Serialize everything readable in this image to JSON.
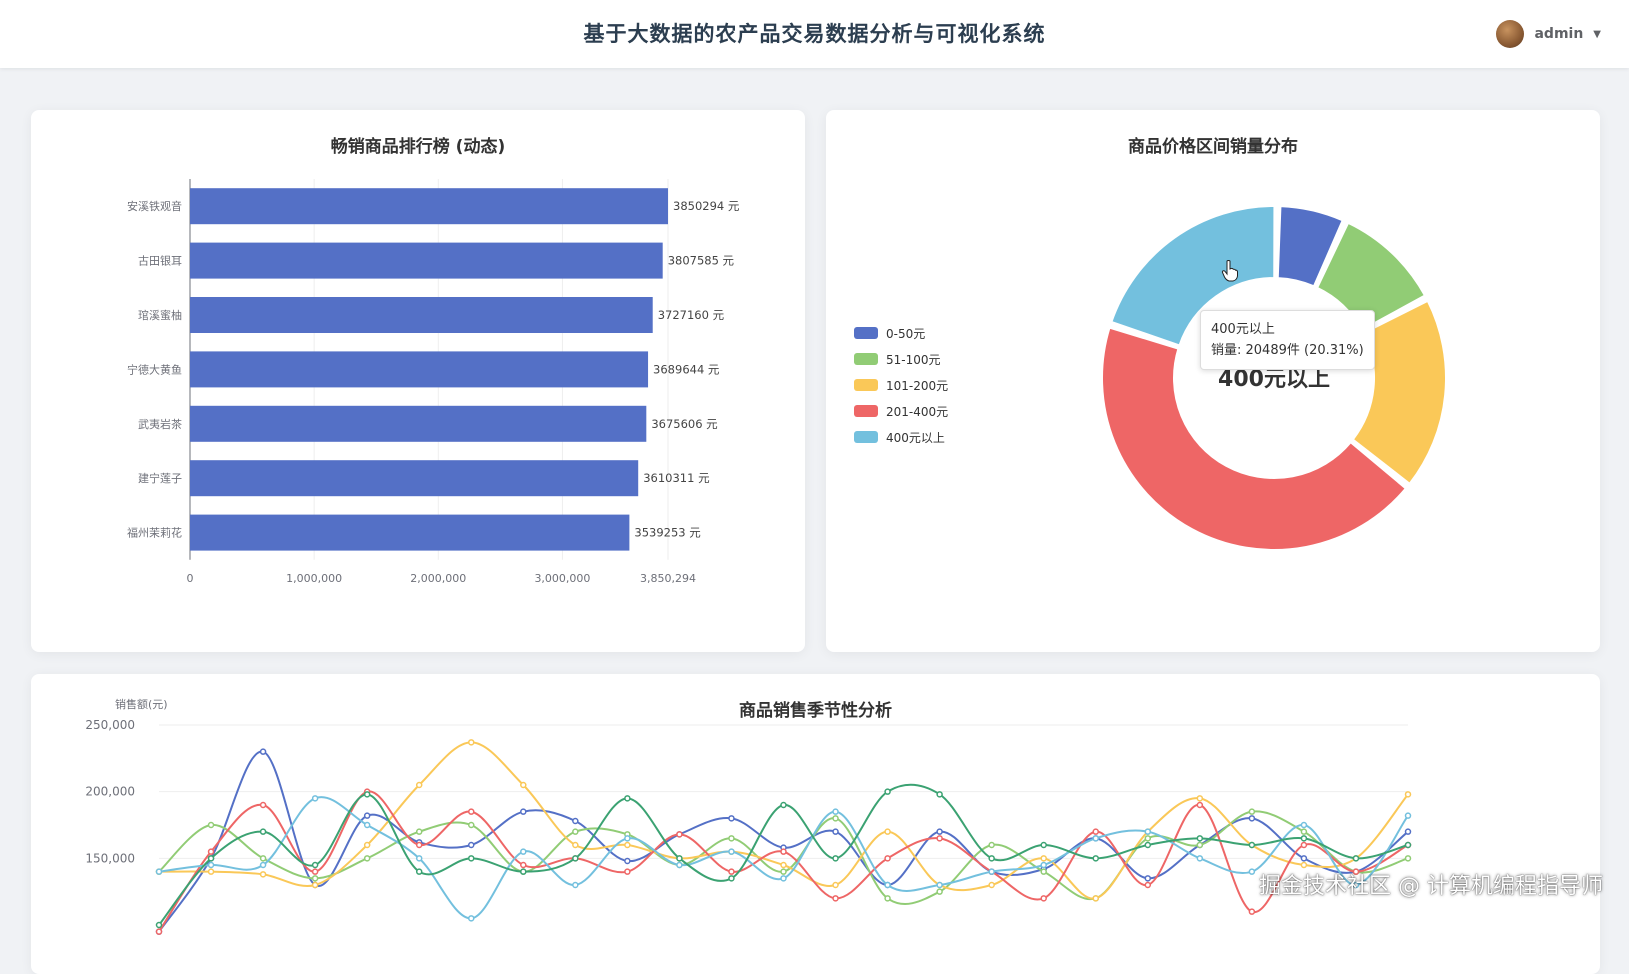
{
  "header": {
    "title": "基于大数据的农产品交易数据分析与可视化系统",
    "username": "admin"
  },
  "ranking": {
    "title": "畅销商品排行榜 (动态)",
    "value_suffix": " 元"
  },
  "price": {
    "title": "商品价格区间销量分布",
    "center_label": "400元以上",
    "tooltip": {
      "name": "400元以上",
      "detail": "销量: 20489件 (20.31%)"
    }
  },
  "season": {
    "title": "商品销售季节性分析",
    "ylabel": "销售额(元)"
  },
  "watermark": "掘金技术社区 @ 计算机编程指导师",
  "chart_data": [
    {
      "type": "bar",
      "orientation": "horizontal",
      "title": "畅销商品排行榜 (动态)",
      "categories": [
        "安溪铁观音",
        "古田银耳",
        "琯溪蜜柚",
        "宁德大黄鱼",
        "武夷岩茶",
        "建宁莲子",
        "福州茉莉花"
      ],
      "values": [
        3850294,
        3807585,
        3727160,
        3689644,
        3675606,
        3610311,
        3539253
      ],
      "xlim": [
        0,
        3850294
      ],
      "xticks": [
        "0",
        "1,000,000",
        "2,000,000",
        "3,000,000",
        "3,850,294"
      ],
      "color": "#5470c6"
    },
    {
      "type": "pie",
      "donut": true,
      "title": "商品价格区间销量分布",
      "labels": [
        "0-50元",
        "51-100元",
        "101-200元",
        "201-400元",
        "400元以上"
      ],
      "values": [
        6.5,
        10.5,
        18.5,
        44.19,
        20.31
      ],
      "colors": [
        "#5470c6",
        "#91cc75",
        "#fac858",
        "#ee6666",
        "#73c0de"
      ],
      "legend": "left"
    },
    {
      "type": "line",
      "smooth": true,
      "title": "商品销售季节性分析",
      "ylabel": "销售额(元)",
      "ylim": [
        100000,
        250000
      ],
      "yticks": [
        "150,000",
        "200,000",
        "250,000"
      ],
      "x_count": 25,
      "series": [
        {
          "color": "#5470c6",
          "values": [
            95000,
            150000,
            230000,
            130000,
            182000,
            162000,
            160000,
            185000,
            178000,
            148000,
            168000,
            180000,
            158000,
            170000,
            130000,
            170000,
            140000,
            142000,
            165000,
            135000,
            160000,
            180000,
            150000,
            140000,
            170000
          ]
        },
        {
          "color": "#91cc75",
          "values": [
            140000,
            175000,
            150000,
            135000,
            150000,
            170000,
            175000,
            140000,
            170000,
            168000,
            145000,
            165000,
            140000,
            180000,
            120000,
            125000,
            160000,
            140000,
            120000,
            165000,
            160000,
            185000,
            170000,
            140000,
            150000
          ]
        },
        {
          "color": "#fac858",
          "values": [
            140000,
            140000,
            138000,
            130000,
            160000,
            205000,
            237000,
            205000,
            160000,
            160000,
            150000,
            155000,
            145000,
            130000,
            170000,
            130000,
            130000,
            150000,
            120000,
            170000,
            195000,
            160000,
            145000,
            150000,
            198000
          ]
        },
        {
          "color": "#ee6666",
          "values": [
            95000,
            155000,
            190000,
            140000,
            200000,
            160000,
            185000,
            145000,
            150000,
            140000,
            168000,
            140000,
            155000,
            120000,
            150000,
            165000,
            140000,
            120000,
            170000,
            130000,
            190000,
            110000,
            160000,
            140000,
            160000
          ]
        },
        {
          "color": "#73c0de",
          "values": [
            140000,
            145000,
            145000,
            195000,
            175000,
            150000,
            105000,
            155000,
            130000,
            165000,
            145000,
            155000,
            135000,
            185000,
            130000,
            130000,
            140000,
            145000,
            165000,
            170000,
            150000,
            140000,
            175000,
            130000,
            182000
          ]
        },
        {
          "color": "#3ba272",
          "values": [
            100000,
            150000,
            170000,
            145000,
            198000,
            140000,
            150000,
            140000,
            150000,
            195000,
            150000,
            135000,
            190000,
            150000,
            200000,
            198000,
            150000,
            160000,
            150000,
            160000,
            165000,
            160000,
            165000,
            150000,
            160000
          ]
        }
      ]
    }
  ]
}
